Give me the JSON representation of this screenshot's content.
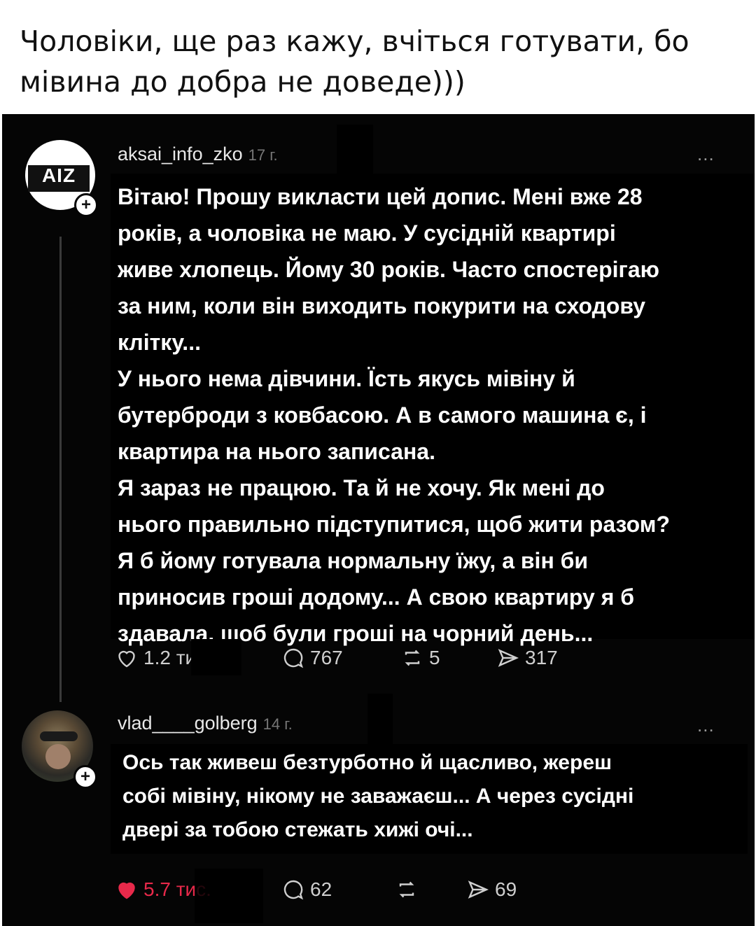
{
  "caption": {
    "lines": [
      "Чоловіки, ще раз кажу, вчіться готувати, бо",
      "мівина до добра не доведе)))"
    ]
  },
  "post1": {
    "avatar_text": "AIZ",
    "username": "aksai_info_zko",
    "time": "17 г.",
    "more": "...",
    "body_lines": [
      "Вітаю! Прошу викласти цей допис. Мені вже 28",
      "років, а чоловіка не маю. У сусідній квартирі",
      "живе хлопець. Йому 30 років. Часто спостерігаю",
      "за ним, коли він виходить покурити на сходову",
      "клітку...",
      "У нього нема дівчини. Їсть якусь мівіну й",
      "бутерброди з ковбасою. А в самого машина є, і",
      "квартира на нього записана.",
      "Я зараз  не працюю. Та й не хочу. Як мені до",
      "нього правильно підступитися, щоб жити разом?",
      "Я б йому готувала нормальну їжу, а він би",
      "приносив гроші додому... А свою квартиру я б",
      "здавала, щоб були гроші на чорний день..."
    ],
    "likes": "1.2 тис.",
    "comments": "767",
    "reposts": "5",
    "shares": "317"
  },
  "post2": {
    "username": "vlad____golberg",
    "time": "14 г.",
    "more": "...",
    "body_lines": [
      "Ось так живеш безтурботно й щасливо, жереш",
      "собі мівіну, нікому не заважаєш... А через сусідні",
      "двері за тобою стежать хижі очі..."
    ],
    "likes": "5.7 тис.",
    "comments": "62",
    "reposts": "",
    "shares": "69",
    "like_color": "#e8294a"
  }
}
